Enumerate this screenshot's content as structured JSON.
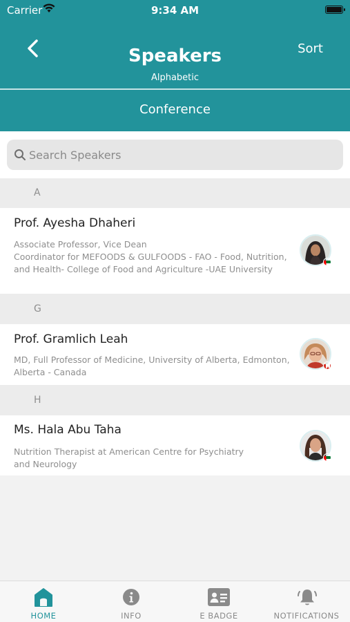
{
  "status_bar": {
    "carrier": "Carrier",
    "time": "9:34 AM"
  },
  "header": {
    "title": "Speakers",
    "subtitle": "Alphabetic",
    "sort_label": "Sort",
    "conference_label": "Conference"
  },
  "search": {
    "placeholder": "Search Speakers",
    "value": ""
  },
  "sections": [
    {
      "letter": "A",
      "speaker": {
        "name": "Prof. Ayesha Dhaheri",
        "description": "Associate Professor, Vice Dean\nCoordinator for MEFOODS & GULFOODS - FAO - Food, Nutrition, and Health- College of Food and Agriculture -UAE University",
        "flag": "UAE"
      }
    },
    {
      "letter": "G",
      "speaker": {
        "name": "Prof. Gramlich Leah",
        "description": "MD, Full Professor of Medicine, University of Alberta, Edmonton, Alberta - Canada",
        "flag": "Canada"
      }
    },
    {
      "letter": "H",
      "speaker": {
        "name": "Ms. Hala Abu Taha",
        "description": "Nutrition Therapist at American Centre for Psychiatry and Neurology",
        "flag": "UAE"
      }
    }
  ],
  "tabbar": {
    "tabs": [
      {
        "label": "HOME",
        "icon": "home-icon",
        "active": true
      },
      {
        "label": "INFO",
        "icon": "info-icon",
        "active": false
      },
      {
        "label": "E BADGE",
        "icon": "badge-icon",
        "active": false
      },
      {
        "label": "NOTIFICATIONS",
        "icon": "bell-icon",
        "active": false
      }
    ]
  },
  "colors": {
    "primary": "#22939b",
    "section_bg": "#ececec",
    "muted_text": "#8e8e8e"
  }
}
